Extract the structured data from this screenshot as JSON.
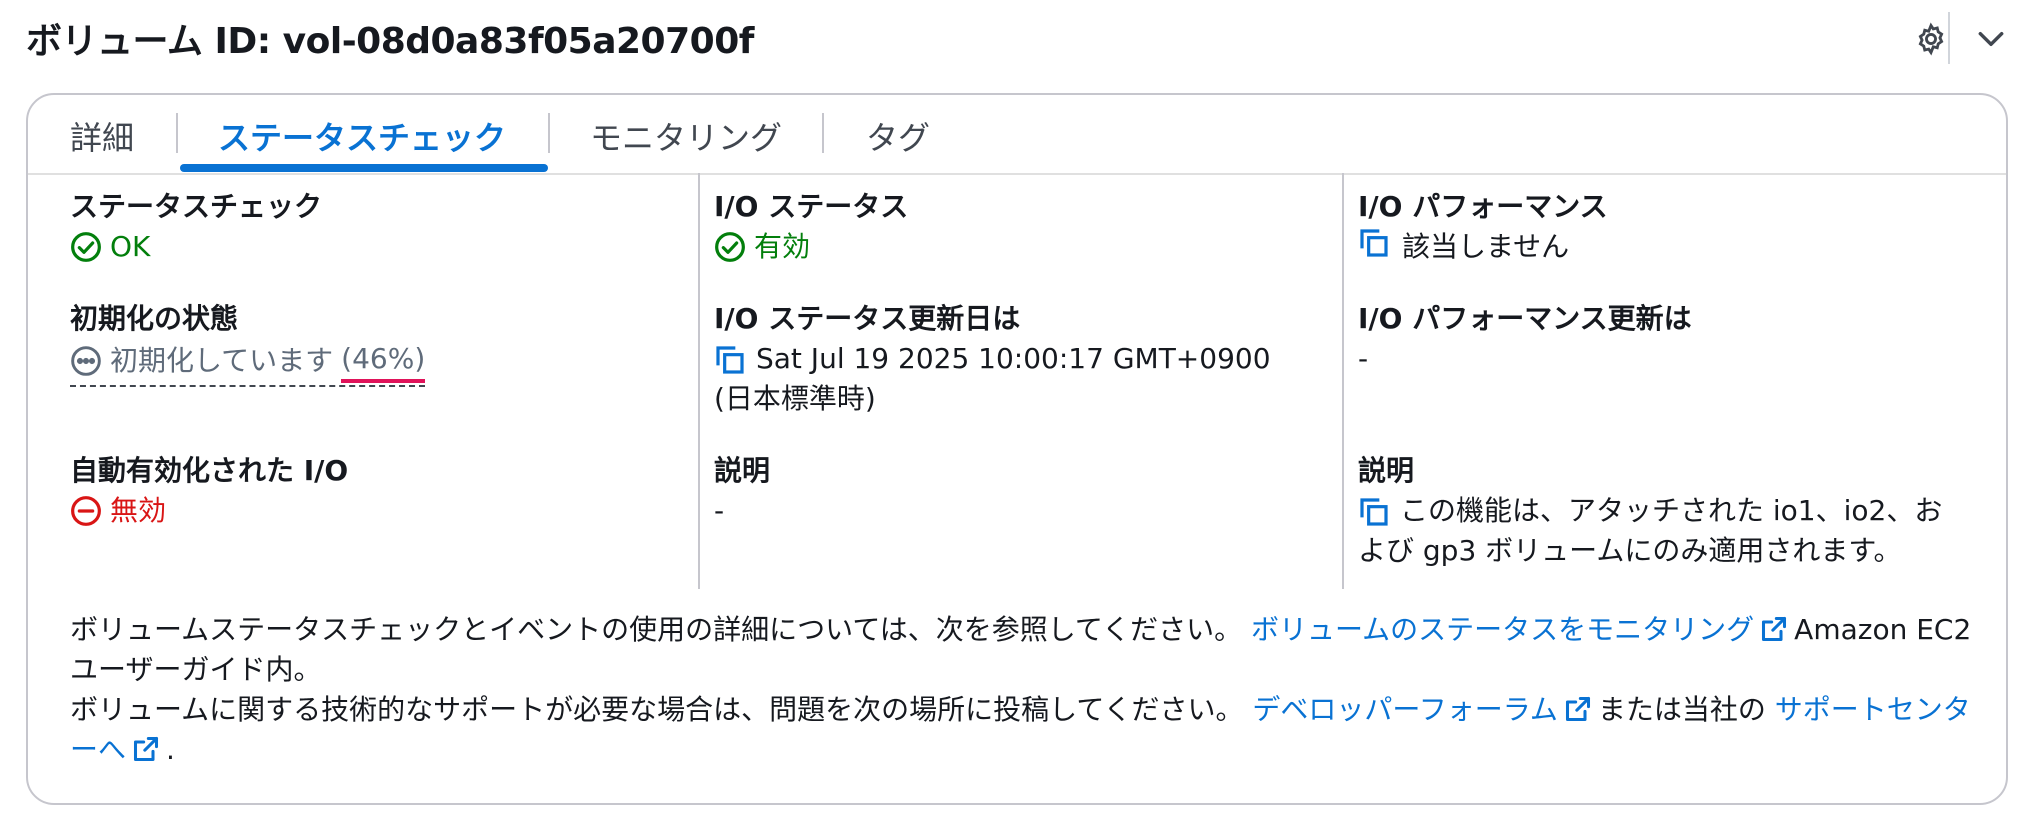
{
  "header": {
    "title": "ボリューム ID: vol-08d0a83f05a20700f"
  },
  "tabs": [
    {
      "label": "詳細",
      "active": false
    },
    {
      "label": "ステータスチェック",
      "active": true
    },
    {
      "label": "モニタリング",
      "active": false
    },
    {
      "label": "タグ",
      "active": false
    }
  ],
  "col1": {
    "status_check": {
      "label": "ステータスチェック",
      "value": "OK"
    },
    "init": {
      "label": "初期化の状態",
      "value": "初期化しています",
      "percent": "(46%)"
    },
    "auto_io": {
      "label": "自動有効化された I/O",
      "value": "無効"
    }
  },
  "col2": {
    "io_status": {
      "label": "I/O ステータス",
      "value": "有効"
    },
    "io_updated": {
      "label": "I/O ステータス更新日は",
      "value": "Sat Jul 19 2025 10:00:17 GMT+0900 (日本標準時)"
    },
    "desc": {
      "label": "説明",
      "value": "-"
    }
  },
  "col3": {
    "io_perf": {
      "label": "I/O パフォーマンス",
      "value": "該当しません"
    },
    "io_perf_updated": {
      "label": "I/O パフォーマンス更新は",
      "value": "-"
    },
    "desc": {
      "label": "説明",
      "value": "この機能は、アタッチされた io1、io2、および gp3 ボリュームにのみ適用されます。"
    }
  },
  "footer": {
    "line1_text": "ボリュームステータスチェックとイベントの使用の詳細については、次を参照してください。 ",
    "line1_link": "ボリュームのステータスをモニタリング",
    "line1_suffix": "Amazon EC2 ユーザーガイド内。",
    "line2_text": "ボリュームに関する技術的なサポートが必要な場合は、問題を次の場所に投稿してください。 ",
    "line2_link1": "デベロッパーフォーラム",
    "line2_mid": "または当社の ",
    "line2_link2": "サポートセンターへ",
    "line2_end": "."
  },
  "colors": {
    "accent": "#0972d3",
    "success": "#037f0c",
    "error": "#d91515"
  }
}
